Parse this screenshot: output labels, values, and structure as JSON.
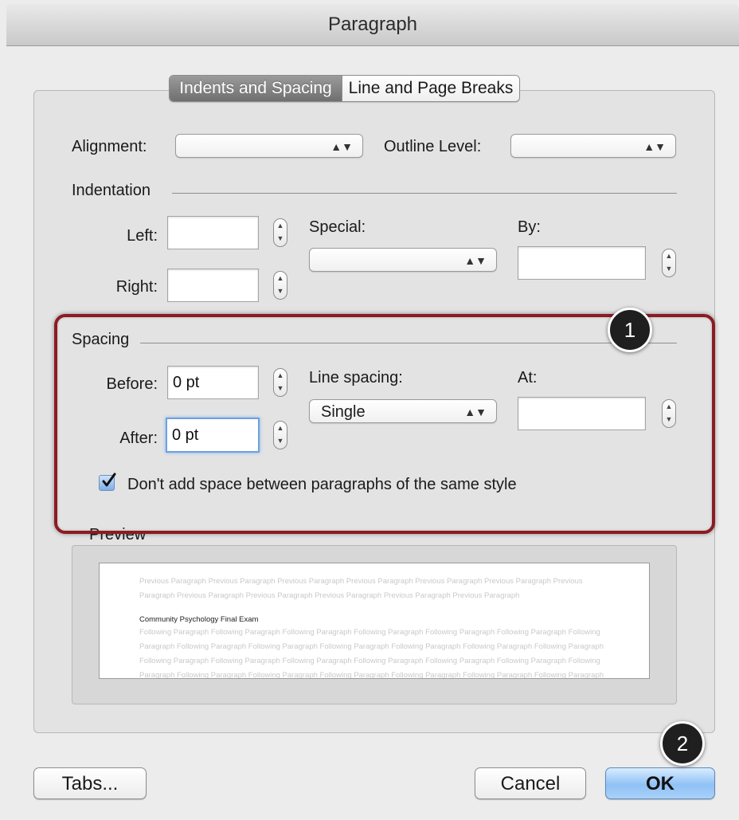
{
  "window": {
    "title": "Paragraph"
  },
  "tabs": [
    {
      "label": "Indents and Spacing",
      "active": true
    },
    {
      "label": "Line and Page Breaks",
      "active": false
    }
  ],
  "general": {
    "alignment_label": "Alignment:",
    "alignment_value": "",
    "outline_label": "Outline Level:",
    "outline_value": ""
  },
  "indentation": {
    "heading": "Indentation",
    "left_label": "Left:",
    "left_value": "",
    "right_label": "Right:",
    "right_value": "",
    "special_label": "Special:",
    "special_value": "",
    "by_label": "By:",
    "by_value": ""
  },
  "spacing": {
    "heading": "Spacing",
    "before_label": "Before:",
    "before_value": "0 pt",
    "after_label": "After:",
    "after_value": "0 pt",
    "line_spacing_label": "Line spacing:",
    "line_spacing_value": "Single",
    "at_label": "At:",
    "at_value": "",
    "dont_add_space_label": "Don't add space between paragraphs of the same style",
    "dont_add_space_checked": true
  },
  "preview": {
    "heading": "Preview",
    "previous_lines": [
      "Previous Paragraph Previous Paragraph Previous Paragraph Previous Paragraph Previous Paragraph Previous Paragraph Previous",
      "Paragraph Previous Paragraph Previous Paragraph Previous Paragraph Previous Paragraph Previous Paragraph"
    ],
    "current_text": "Community Psychology Final Exam",
    "following_lines": [
      "Following Paragraph Following Paragraph Following Paragraph Following Paragraph Following Paragraph Following Paragraph Following",
      "Paragraph Following Paragraph Following Paragraph Following Paragraph Following Paragraph Following Paragraph Following Paragraph",
      "Following Paragraph Following Paragraph Following Paragraph Following Paragraph Following Paragraph Following Paragraph Following",
      "Paragraph Following Paragraph Following Paragraph Following Paragraph Following Paragraph Following Paragraph Following Paragraph"
    ]
  },
  "annotations": {
    "badge_1": "1",
    "badge_2": "2"
  },
  "footer": {
    "tabs_label": "Tabs...",
    "cancel_label": "Cancel",
    "ok_label": "OK"
  },
  "colors": {
    "highlight": "#8b1b24",
    "default_button": "#8fc1f5",
    "checkbox": "#7eaee6"
  }
}
